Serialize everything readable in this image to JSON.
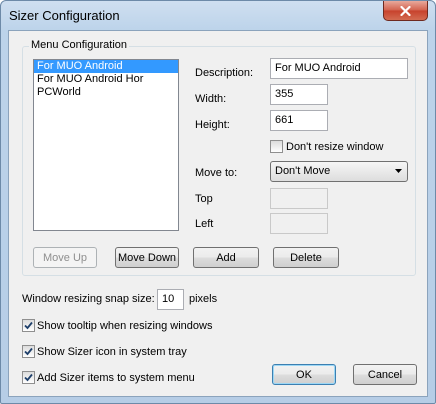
{
  "window": {
    "title": "Sizer Configuration"
  },
  "group": {
    "legend": "Menu Configuration",
    "list_items": [
      "For MUO Android",
      "For MUO Android Hor",
      "PCWorld"
    ],
    "selected_index": 0
  },
  "fields": {
    "description_label": "Description:",
    "description_value": "For MUO Android",
    "width_label": "Width:",
    "width_value": "355",
    "height_label": "Height:",
    "height_value": "661",
    "dont_resize_label": "Don't resize window",
    "dont_resize_checked": false,
    "move_to_label": "Move to:",
    "move_to_value": "Don't Move",
    "top_label": "Top",
    "top_value": "",
    "left_label": "Left",
    "left_value": ""
  },
  "group_buttons": {
    "move_up": "Move Up",
    "move_down": "Move Down",
    "add": "Add",
    "delete": "Delete"
  },
  "options": {
    "snap_label": "Window resizing snap size:",
    "snap_value": "10",
    "snap_unit": "pixels",
    "tooltip_label": "Show tooltip when resizing windows",
    "tooltip_checked": true,
    "tray_label": "Show Sizer icon in system tray",
    "tray_checked": true,
    "menu_label": "Add Sizer items to system menu",
    "menu_checked": true
  },
  "dialog_buttons": {
    "ok": "OK",
    "cancel": "Cancel"
  },
  "icons": {
    "close": "close-icon",
    "checkmark": "checkmark-icon",
    "dropdown": "chevron-down-icon"
  },
  "colors": {
    "selection": "#3399ff",
    "dialog_bg": "#f0f0f0",
    "title_bg": "#bcd3ea",
    "close_button": "#c7412c"
  }
}
